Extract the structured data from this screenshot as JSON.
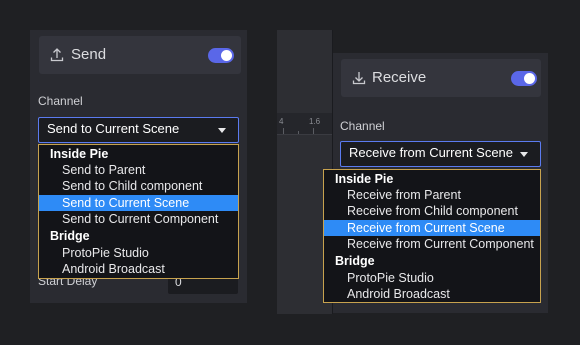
{
  "send_panel": {
    "title": "Send",
    "icon": "upload-icon",
    "toggle_on": true,
    "channel_label": "Channel",
    "selected": "Send to Current Scene",
    "hidden_label": "Start Delay",
    "hidden_value": "0",
    "menu": {
      "groups": [
        {
          "label": "Inside Pie",
          "items": [
            "Send to Parent",
            "Send to Child component",
            "Send to Current Scene",
            "Send to Current Component"
          ]
        },
        {
          "label": "Bridge",
          "items": [
            "ProtoPie Studio",
            "Android Broadcast"
          ]
        }
      ],
      "highlighted": "Send to Current Scene"
    }
  },
  "receive_panel": {
    "title": "Receive",
    "icon": "download-icon",
    "toggle_on": true,
    "channel_label": "Channel",
    "selected": "Receive from Current Scene",
    "menu": {
      "groups": [
        {
          "label": "Inside Pie",
          "items": [
            "Receive from Parent",
            "Receive from Child component",
            "Receive from Current Scene",
            "Receive from Current Component"
          ]
        },
        {
          "label": "Bridge",
          "items": [
            "ProtoPie Studio",
            "Android Broadcast"
          ]
        }
      ],
      "highlighted": "Receive from Current Scene"
    }
  },
  "ruler": {
    "ticks": [
      "4",
      "1.6"
    ]
  },
  "colors": {
    "accent": "#5a67e8",
    "highlight": "#2e8bf6",
    "menu_border": "#c7a24e",
    "panel": "#2a2b31"
  }
}
